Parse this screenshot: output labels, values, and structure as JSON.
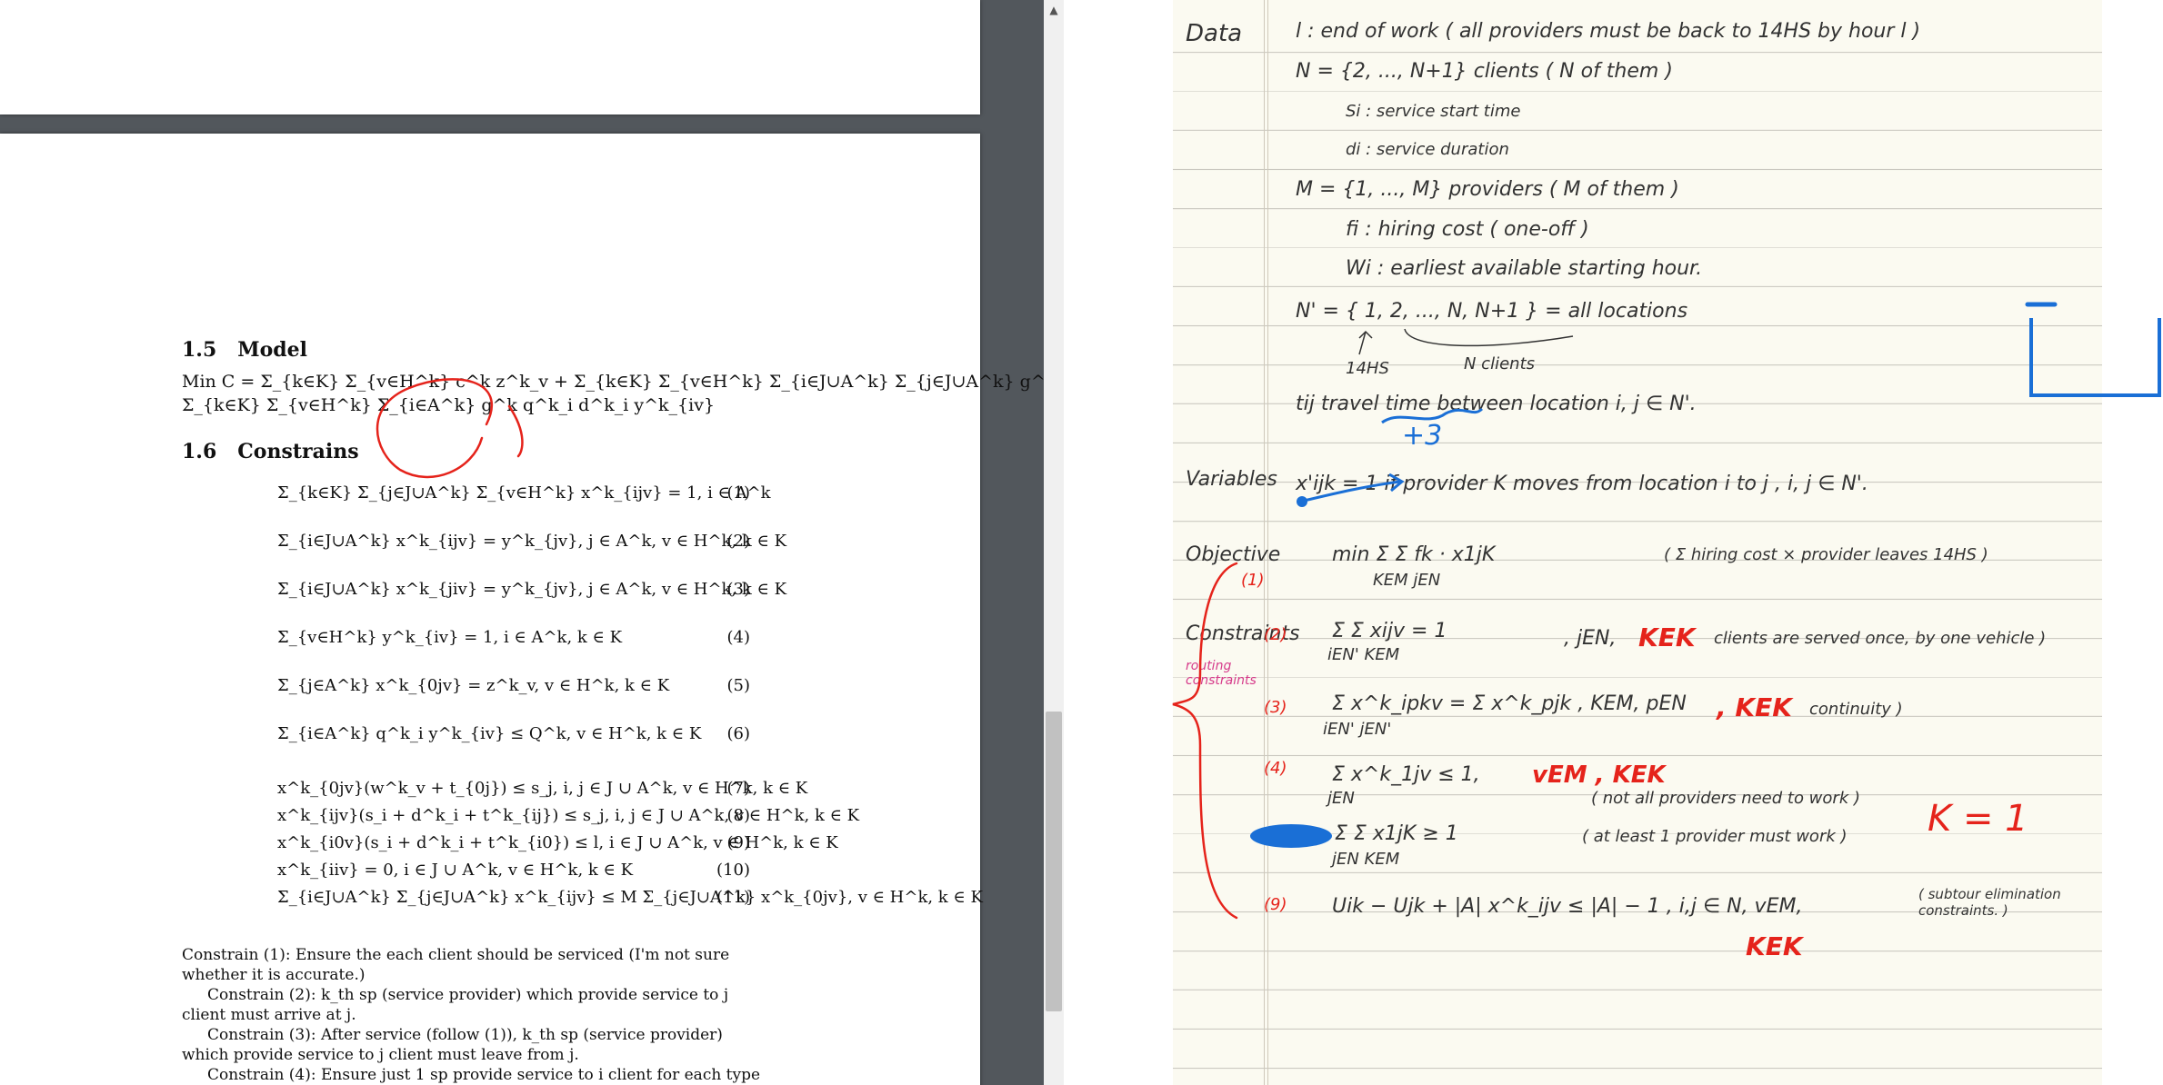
{
  "pdf": {
    "section_model": {
      "number": "1.5",
      "title": "Model"
    },
    "objective": {
      "line1": "Min  C = Σ_{k∈K} Σ_{v∈H^k} c^k z^k_v + Σ_{k∈K} Σ_{v∈H^k} Σ_{i∈J∪A^k} Σ_{j∈J∪A^k} g^k t^k_{ij} x^k_{ijv} +",
      "line2": "Σ_{k∈K} Σ_{v∈H^k} Σ_{i∈A^k} g^k q^k_i d^k_i y^k_{iv}"
    },
    "section_constrains": {
      "number": "1.6",
      "title": "Constrains"
    },
    "constraints": [
      {
        "formula": "Σ_{k∈K} Σ_{j∈J∪A^k} Σ_{v∈H^k} x^k_{ijv} = 1, i ∈ A^k",
        "number": "(1)"
      },
      {
        "formula": "Σ_{i∈J∪A^k} x^k_{ijv} = y^k_{jv}, j ∈ A^k, v ∈ H^k, k ∈ K",
        "number": "(2)"
      },
      {
        "formula": "Σ_{i∈J∪A^k} x^k_{jiv} = y^k_{jv}, j ∈ A^k, v ∈ H^k, k ∈ K",
        "number": "(3)"
      },
      {
        "formula": "Σ_{v∈H^k} y^k_{iv} = 1, i ∈ A^k, k ∈ K",
        "number": "(4)"
      },
      {
        "formula": "Σ_{j∈A^k} x^k_{0jv} = z^k_v, v ∈ H^k, k ∈ K",
        "number": "(5)"
      },
      {
        "formula": "Σ_{i∈A^k} q^k_i y^k_{iv} ≤ Q^k, v ∈ H^k, k ∈ K",
        "number": "(6)"
      },
      {
        "formula": "x^k_{0jv}(w^k_v + t_{0j}) ≤ s_j, i, j ∈ J ∪ A^k, v ∈ H^k, k ∈ K",
        "number": "(7)"
      },
      {
        "formula": "x^k_{ijv}(s_i + d^k_i + t^k_{ij}) ≤ s_j, i, j ∈ J ∪ A^k, v ∈ H^k, k ∈ K",
        "number": "(8)"
      },
      {
        "formula": "x^k_{i0v}(s_i + d^k_i + t^k_{i0}) ≤ l, i ∈ J ∪ A^k, v ∈ H^k, k ∈ K",
        "number": "(9)"
      },
      {
        "formula": "x^k_{iiv} = 0, i ∈ J ∪ A^k, v ∈ H^k, k ∈ K",
        "number": "(10)"
      },
      {
        "formula": "Σ_{i∈J∪A^k} Σ_{j∈J∪A^k} x^k_{ijv} ≤ M Σ_{j∈J∪A^k} x^k_{0jv}, v ∈ H^k, k ∈ K",
        "number": "(11)"
      }
    ],
    "explanations": [
      "Constrain (1): Ensure the each client should be serviced (I'm not sure whether it is accurate.)",
      "Constrain (2): k_th sp (service provider) which provide service to j client must arrive at j.",
      "Constrain (3): After service (follow (1)), k_th sp (service provider) which provide service to j client must leave from j.",
      "Constrain (4): Ensure just 1 sp provide service to i client for each type"
    ],
    "scroll_up_glyph": "▲"
  },
  "notes": {
    "data_label": "Data",
    "l_line": "l  :   end of work   ( all providers must be back to 14HS by hour l )",
    "N_line": "N = {2, ..., N+1}   clients  ( N of them )",
    "si_line": "Si :  service  start  time",
    "di_line": "di :  service  duration",
    "M_line": "M  =  {1, ..., M}  providers   ( M of them )",
    "fi_line": "fi :  hiring  cost   ( one-off )",
    "wi_line": "Wi :  earliest  available  starting  hour.",
    "Nprime_line": "N'  =  { 1, 2, ..., N, N+1 }    =  all   locations",
    "hq_label": "14HS",
    "nclients_label": "N  clients",
    "tij_line": "tij  travel  time   between  location   i, j ∈ N'.",
    "red_plus3": "+3",
    "variables_label": "Variables",
    "x_line": "x'ijk  =  1  if  provider  K  moves  from  location  i  to  j ,  i, j ∈ N'.",
    "objective_label": "Objective",
    "obj_formula": "min  Σ  Σ   fk · x1jK",
    "obj_sub": "KEM jEN",
    "obj_note": "( Σ  hiring cost  ×  provider  leaves 14HS )",
    "obj_num": "(1)",
    "constraints_label": "Constraints",
    "routing_label": "routing constraints",
    "c2_num": "(2)",
    "c2_formula": "Σ  Σ   xijv   =  1",
    "c2_sub": "iEN'  KEM",
    "c2_cond": ", jEN,",
    "c2_red": "KEK",
    "c2_note": "clients  are  served  once,  by  one  vehicle )",
    "c3_num": "(3)",
    "c3_formula": "Σ   x^k_ipkv   =   Σ   x^k_pjk  ,   KEM, pEN",
    "c3_sub": "iEN'                      jEN'",
    "c3_red": ", KEK",
    "c3_note": "continuity )",
    "c4_num": "(4)",
    "c4_formula": "Σ   x^k_1jv   ≤  1,",
    "c4_sub": "jEN",
    "c4_red": "vEM , KEK",
    "c4_note": "( not all  providers  need  to  work )",
    "k_eq_1": "K = 1",
    "c5_formula": "Σ  Σ    x1jK     ≥   1",
    "c5_sub": "jEN  KEM",
    "c5_note": "( at  least  1  provider  must  work )",
    "c9_num": "(9)",
    "c9_formula": "Uik  −  Ujk  +  |A| x^k_ijv  ≤  |A| − 1 ,   i,j ∈ N,  vEM,",
    "c9_note": "( subtour  elimination constraints. )",
    "red_KEK": "KEK"
  }
}
